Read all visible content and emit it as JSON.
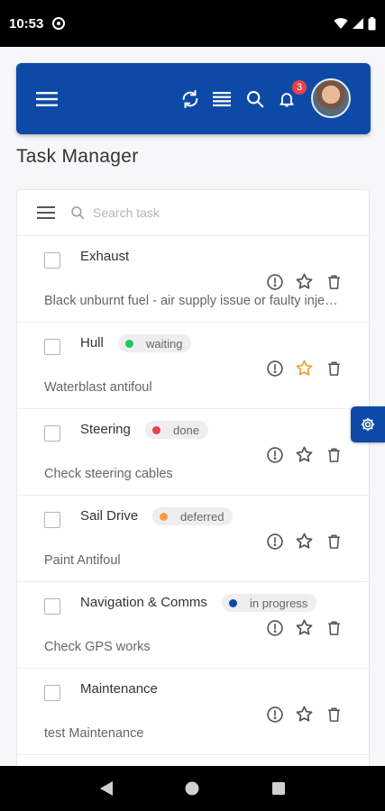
{
  "status_bar": {
    "time": "10:53",
    "icons": [
      "wifi-icon",
      "signal-icon",
      "battery-icon"
    ]
  },
  "header": {
    "icons": [
      "menu-icon",
      "refresh-icon",
      "list-icon",
      "search-icon",
      "bell-icon"
    ],
    "notification_count": "3",
    "accent": "#0d4aa8",
    "badge_color": "#e8424a"
  },
  "page": {
    "title": "Task Manager"
  },
  "search": {
    "placeholder": "Search task",
    "value": ""
  },
  "tasks": [
    {
      "title": "Exhaust",
      "status": "",
      "status_color": "",
      "description": "Black unburnt fuel - air supply issue or faulty injector",
      "starred": false
    },
    {
      "title": "Hull",
      "status": "waiting",
      "status_color": "#22c55e",
      "description": "Waterblast antifoul",
      "starred": true
    },
    {
      "title": "Steering",
      "status": "done",
      "status_color": "#e8424a",
      "description": "Check steering cables",
      "starred": false
    },
    {
      "title": "Sail Drive",
      "status": "deferred",
      "status_color": "#f59e3c",
      "description": "Paint Antifoul",
      "starred": false
    },
    {
      "title": "Navigation & Comms",
      "status": "in progress",
      "status_color": "#0d4aa8",
      "description": "Check GPS works",
      "starred": false
    },
    {
      "title": "Maintenance",
      "status": "",
      "status_color": "",
      "description": "test Maintenance",
      "starred": false
    }
  ],
  "colors": {
    "star_active": "#f59e3c",
    "icon_gray": "#555555"
  }
}
